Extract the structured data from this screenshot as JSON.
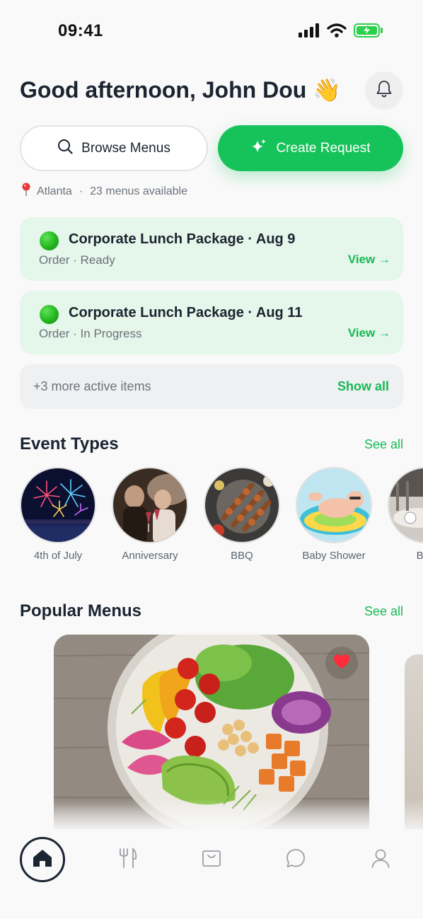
{
  "status_bar": {
    "time": "09:41",
    "icons": [
      "signal-icon",
      "wifi-icon",
      "battery-charging-icon"
    ]
  },
  "header": {
    "greeting": "Good afternoon, John Dou 👋",
    "notification_icon": "bell-icon"
  },
  "actions": {
    "browse_label": "Browse Menus",
    "create_label": "Create Request"
  },
  "location": {
    "city": "Atlanta",
    "separator": "·",
    "menus_available": "23 menus available"
  },
  "orders": [
    {
      "title": "Corporate Lunch Package · Aug 9",
      "status": "Order · Ready",
      "action": "View →"
    },
    {
      "title": "Corporate Lunch Package · Aug 11",
      "status": "Order · In Progress",
      "action": "View →"
    }
  ],
  "more_items": {
    "text": "+3 more active items",
    "action": "Show all"
  },
  "event_types": {
    "title": "Event Types",
    "see_all": "See all",
    "items": [
      {
        "label": "4th of July"
      },
      {
        "label": "Anniversary"
      },
      {
        "label": "BBQ"
      },
      {
        "label": "Baby Shower"
      },
      {
        "label": "Ban"
      }
    ]
  },
  "popular_menus": {
    "title": "Popular Menus",
    "see_all": "See all"
  },
  "bottom_nav": [
    "home-icon",
    "utensils-icon",
    "bag-icon",
    "chat-icon",
    "profile-icon"
  ],
  "colors": {
    "accent": "#16c25a",
    "card_green": "#e5f6ea",
    "text_dark": "#1b2431",
    "text_muted": "#6b737c"
  }
}
